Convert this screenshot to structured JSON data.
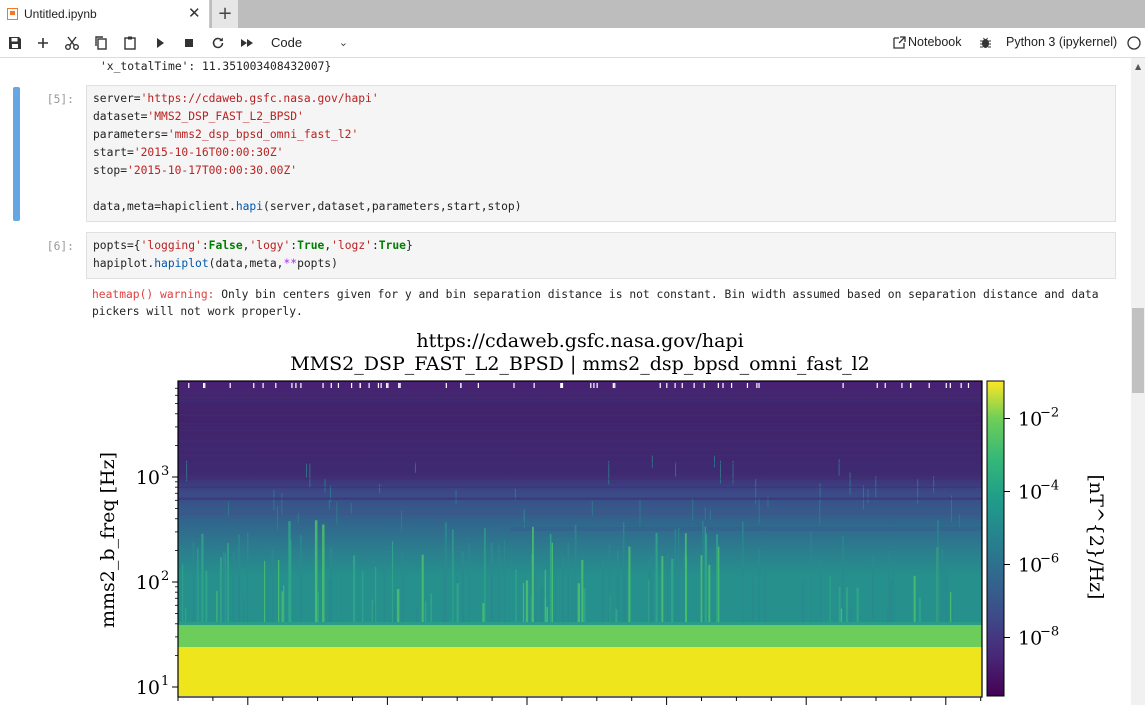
{
  "tab": {
    "label": "Untitled.ipynb",
    "close": "✕",
    "add": "+"
  },
  "toolbar": {
    "cell_type": "Code",
    "notebook_label": "Notebook",
    "kernel_label": "Python 3 (ipykernel)"
  },
  "prev_output": "'x_totalTime': 11.351003408432007}",
  "cells": [
    {
      "prompt": "[5]:",
      "lines": [
        [
          "server=",
          "'https://cdaweb.gsfc.nasa.gov/hapi'"
        ],
        [
          "dataset=",
          "'MMS2_DSP_FAST_L2_BPSD'"
        ],
        [
          "parameters=",
          "'mms2_dsp_bpsd_omni_fast_l2'"
        ],
        [
          "start=",
          "'2015-10-16T00:00:30Z'"
        ],
        [
          "stop=",
          "'2015-10-17T00:00:30.00Z'"
        ],
        [
          "data,meta=hapiclient.",
          "hapi",
          "(server,dataset,parameters,start,stop)"
        ]
      ]
    },
    {
      "prompt": "[6]:",
      "line1": {
        "a": "popts={",
        "s1": "'logging'",
        "c1": ":",
        "k1": "False",
        "c2": ",",
        "s2": "'logy'",
        "c3": ":",
        "k2": "True",
        "c4": ",",
        "s3": "'logz'",
        "c5": ":",
        "k3": "True",
        "c6": "}"
      },
      "line2": {
        "a": "hapiplot.",
        "fn": "hapiplot",
        "b": "(data,meta,",
        "op": "**",
        "c": "popts)"
      }
    }
  ],
  "warning": {
    "prefix": "heatmap() warning:",
    "message": " Only bin centers given for y and bin separation distance is not constant. Bin width assumed based on separation distance and data pickers will not work properly."
  },
  "chart_data": {
    "type": "heatmap",
    "title": "https://cdaweb.gsfc.nasa.gov/hapi",
    "subtitle": "MMS2_DSP_FAST_L2_BPSD | mms2_dsp_bpsd_omni_fast_l2",
    "ylabel": "mms2_b_freq [Hz]",
    "yscale": "log",
    "yticks": [
      {
        "value": 10,
        "label": "10",
        "exp": "1"
      },
      {
        "value": 100,
        "label": "10",
        "exp": "2"
      },
      {
        "value": 1000,
        "label": "10",
        "exp": "3"
      }
    ],
    "colorbar": {
      "label": "[nT^{2}/Hz]",
      "scale": "log",
      "colormap": "viridis",
      "ticks": [
        {
          "value": 0.01,
          "label": "10",
          "exp": "−2"
        },
        {
          "value": 0.0001,
          "label": "10",
          "exp": "−4"
        },
        {
          "value": 1e-06,
          "label": "10",
          "exp": "−6"
        },
        {
          "value": 1e-08,
          "label": "10",
          "exp": "−8"
        }
      ]
    },
    "bands": [
      {
        "freq_range": "~40 Hz",
        "level": "~1e-4"
      },
      {
        "freq_range": "<25 Hz",
        "level": "~1e-2"
      }
    ]
  }
}
